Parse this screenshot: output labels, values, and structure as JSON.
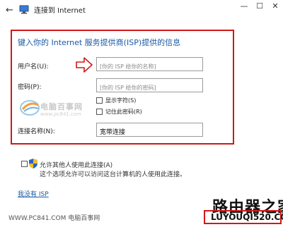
{
  "window": {
    "title": "连接到 Internet",
    "back_icon": "arrow-left-icon",
    "minimize_glyph": "—",
    "maximize_glyph": "☐",
    "close_glyph": "✕"
  },
  "form": {
    "heading": "键入你的 Internet 服务提供商(ISP)提供的信息",
    "username_label": "用户名(U):",
    "username_placeholder": "[你的 ISP 给你的名称]",
    "password_label": "密码(P):",
    "password_placeholder": "[你的 ISP 给你的密码]",
    "show_chars_label": "显示字符(S)",
    "remember_password_label": "记住此密码(R)",
    "connection_name_label": "连接名称(N):",
    "connection_name_value": "宽带连接"
  },
  "sharing": {
    "allow_label": "允许其他人使用此连接(A)",
    "allow_description": "这个选项允许可以访问这台计算机的人使用此连接。"
  },
  "links": {
    "no_isp": "我没有 ISP"
  },
  "watermark": {
    "name": "电脑百事网",
    "url": "www.pc841.com"
  },
  "footer": {
    "left_text": "WWW.PC841.COM 电脑百事网",
    "brand": "路由器之家",
    "domain": "LUYOUQI520.COM"
  },
  "colors": {
    "highlight_red": "#d01818",
    "heading_blue": "#1a5aa6"
  }
}
